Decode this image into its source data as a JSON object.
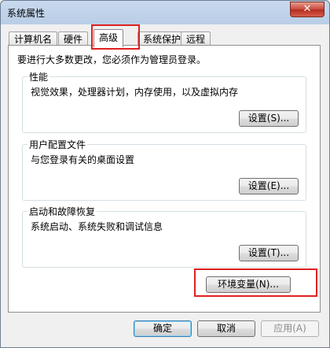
{
  "window": {
    "title": "系统属性",
    "close_glyph": "✕"
  },
  "tabs": [
    {
      "label": "计算机名"
    },
    {
      "label": "硬件"
    },
    {
      "label": "高级",
      "active": true
    },
    {
      "label": "系统保护"
    },
    {
      "label": "远程"
    }
  ],
  "advanced": {
    "intro": "要进行大多数更改，您必须作为管理员登录。",
    "performance": {
      "title": "性能",
      "description": "视觉效果，处理器计划，内存使用，以及虚拟内存",
      "button": "设置(S)..."
    },
    "user_profiles": {
      "title": "用户配置文件",
      "description": "与您登录有关的桌面设置",
      "button": "设置(E)..."
    },
    "startup_recovery": {
      "title": "启动和故障恢复",
      "description": "系统启动、系统失败和调试信息",
      "button": "设置(T)..."
    },
    "env_button": "环境变量(N)..."
  },
  "footer": {
    "ok": "确定",
    "cancel": "取消",
    "apply": "应用(A)"
  },
  "colors": {
    "highlight": "#e02020",
    "accent_border": "#3c7fb1"
  },
  "icons": {
    "close": "close-icon"
  }
}
